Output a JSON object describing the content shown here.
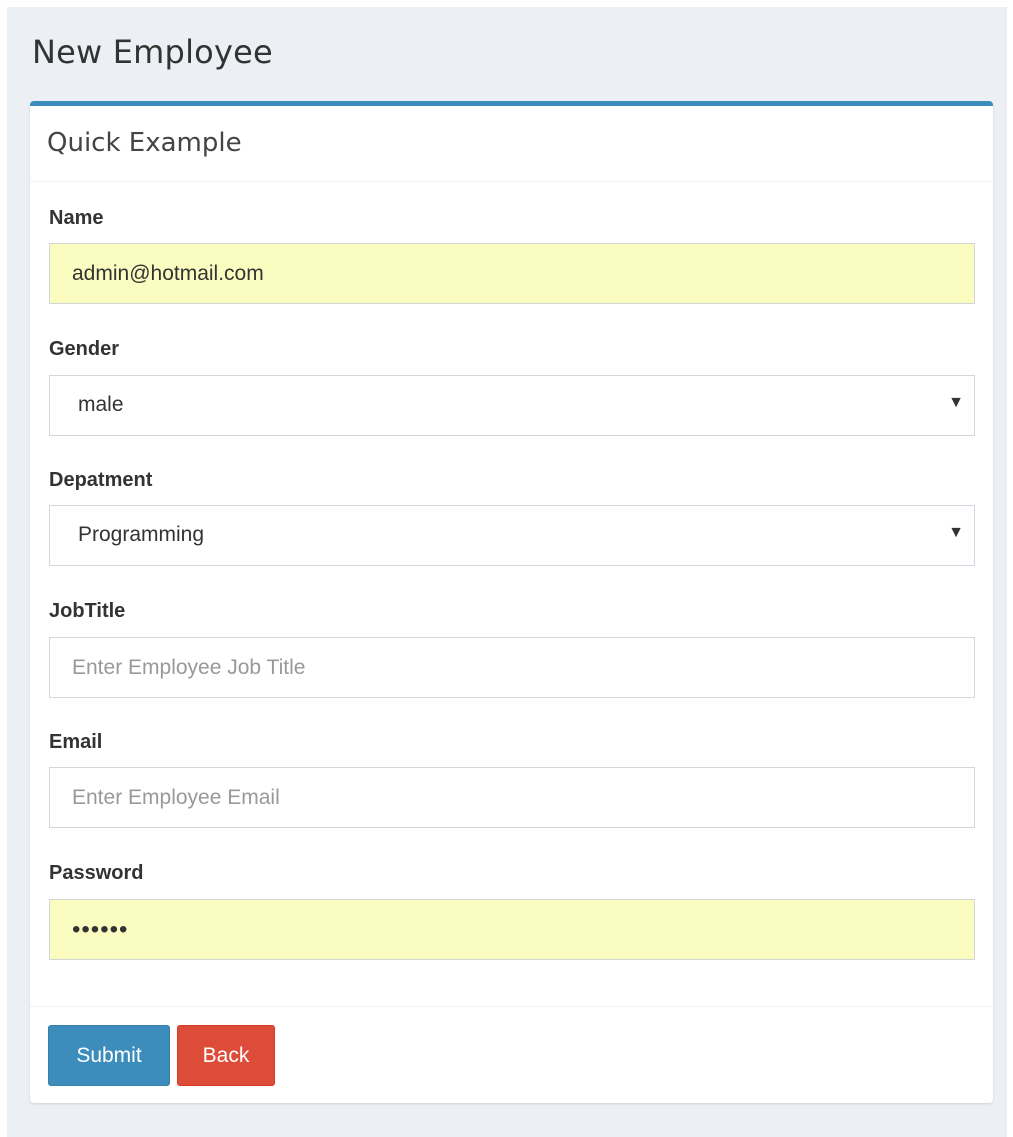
{
  "page": {
    "title": "New Employee"
  },
  "box": {
    "title": "Quick Example"
  },
  "form": {
    "name": {
      "label": "Name",
      "value": "admin@hotmail.com"
    },
    "gender": {
      "label": "Gender",
      "selected": "male"
    },
    "department": {
      "label": "Depatment",
      "selected": "Programming"
    },
    "job_title": {
      "label": "JobTitle",
      "placeholder": "Enter Employee Job Title",
      "value": ""
    },
    "email": {
      "label": "Email",
      "placeholder": "Enter Employee Email",
      "value": ""
    },
    "password": {
      "label": "Password",
      "value": "••••••"
    }
  },
  "buttons": {
    "submit_label": "Submit",
    "back_label": "Back"
  },
  "icons": {
    "dropdown_caret": "▼"
  },
  "colors": {
    "primary": "#3c8dbc",
    "danger": "#dd4b39",
    "autofill": "#fafcc0",
    "background": "#ecf0f5"
  }
}
